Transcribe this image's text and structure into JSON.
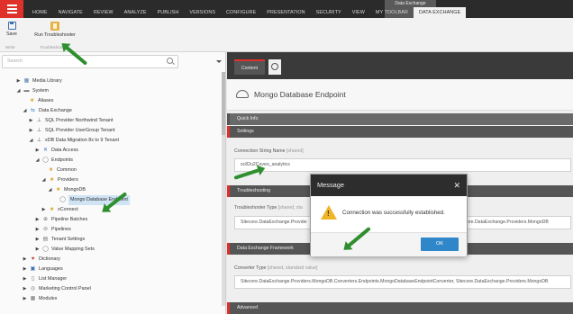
{
  "ribbon": {
    "tabs": [
      "HOME",
      "NAVIGATE",
      "REVIEW",
      "ANALYZE",
      "PUBLISH",
      "VERSIONS",
      "CONFIGURE",
      "PRESENTATION",
      "SECURITY",
      "VIEW",
      "MY TOOLBAR",
      "DATA EXCHANGE"
    ],
    "contextual_title": "Data Exchange"
  },
  "toolbar": {
    "save_label": "Save",
    "save_group": "Write",
    "run_label": "Run Troubleshooter",
    "run_group": "Troubleshooter"
  },
  "tree": {
    "search_placeholder": "Search",
    "nodes": [
      {
        "label": "Media Library",
        "icon": "media-icon"
      },
      {
        "label": "System",
        "icon": "system-icon"
      },
      {
        "label": "Aliases",
        "icon": "folder-icon"
      },
      {
        "label": "Data Exchange",
        "icon": "data-exchange-icon"
      },
      {
        "label": "SQL Provider Northwind Tenant",
        "icon": "tenant-icon"
      },
      {
        "label": "SQL Provider UserGroup Tenant",
        "icon": "tenant-icon"
      },
      {
        "label": "xDB Data Migration 8x to 9 Tenant",
        "icon": "tenant-icon"
      },
      {
        "label": "Data Access",
        "icon": "data-access-icon"
      },
      {
        "label": "Endpoints",
        "icon": "endpoint-icon"
      },
      {
        "label": "Common",
        "icon": "folder-icon"
      },
      {
        "label": "Providers",
        "icon": "folder-icon"
      },
      {
        "label": "MongoDB",
        "icon": "folder-icon"
      },
      {
        "label": "Mongo Database Endpoint",
        "icon": "endpoint-icon"
      },
      {
        "label": "xConnect",
        "icon": "folder-icon"
      },
      {
        "label": "Pipeline Batches",
        "icon": "pipeline-icon"
      },
      {
        "label": "Pipelines",
        "icon": "pipeline-icon"
      },
      {
        "label": "Tenant Settings",
        "icon": "settings-icon"
      },
      {
        "label": "Value Mapping Sets",
        "icon": "mapping-icon"
      },
      {
        "label": "Dictionary",
        "icon": "dictionary-icon"
      },
      {
        "label": "Languages",
        "icon": "languages-icon"
      },
      {
        "label": "List Manager",
        "icon": "list-icon"
      },
      {
        "label": "Marketing Control Panel",
        "icon": "marketing-icon"
      },
      {
        "label": "Modules",
        "icon": "modules-icon"
      }
    ]
  },
  "content": {
    "tab_label": "Content",
    "item_title": "Mongo Database Endpoint",
    "sections": {
      "quick_info": "Quick Info",
      "settings": "Settings",
      "troubleshooting": "Troubleshooting",
      "framework": "Data Exchange Framework",
      "advanced": "Advanced"
    },
    "connection_label": "Connection String Name",
    "connection_hint": "[shared]",
    "connection_value": "sc82u2Coveo_analytics",
    "troubleshooter_label": "Troubleshooter Type",
    "troubleshooter_hint": "[shared, sta",
    "troubleshooter_value": "Sitecore.DataExchange.Provide",
    "troubleshooter_value_right": "ore.DataExchange.Providers.MongoDB",
    "converter_label": "Converter Type",
    "converter_hint": "[shared, standard value]",
    "converter_value": "Sitecore.DataExchange.Providers.MongoDB.Converters.Endpoints.MongoDatabaseEndpointConverter, Sitecore.DataExchange.Providers.MongoDB"
  },
  "modal": {
    "title": "Message",
    "message": "Connection was successfully established.",
    "ok_label": "OK"
  },
  "colors": {
    "accent_red": "#e0302a",
    "ok_blue": "#2f86c8",
    "annotation_green": "#2f8f2f",
    "warning_yellow": "#f0b429"
  }
}
